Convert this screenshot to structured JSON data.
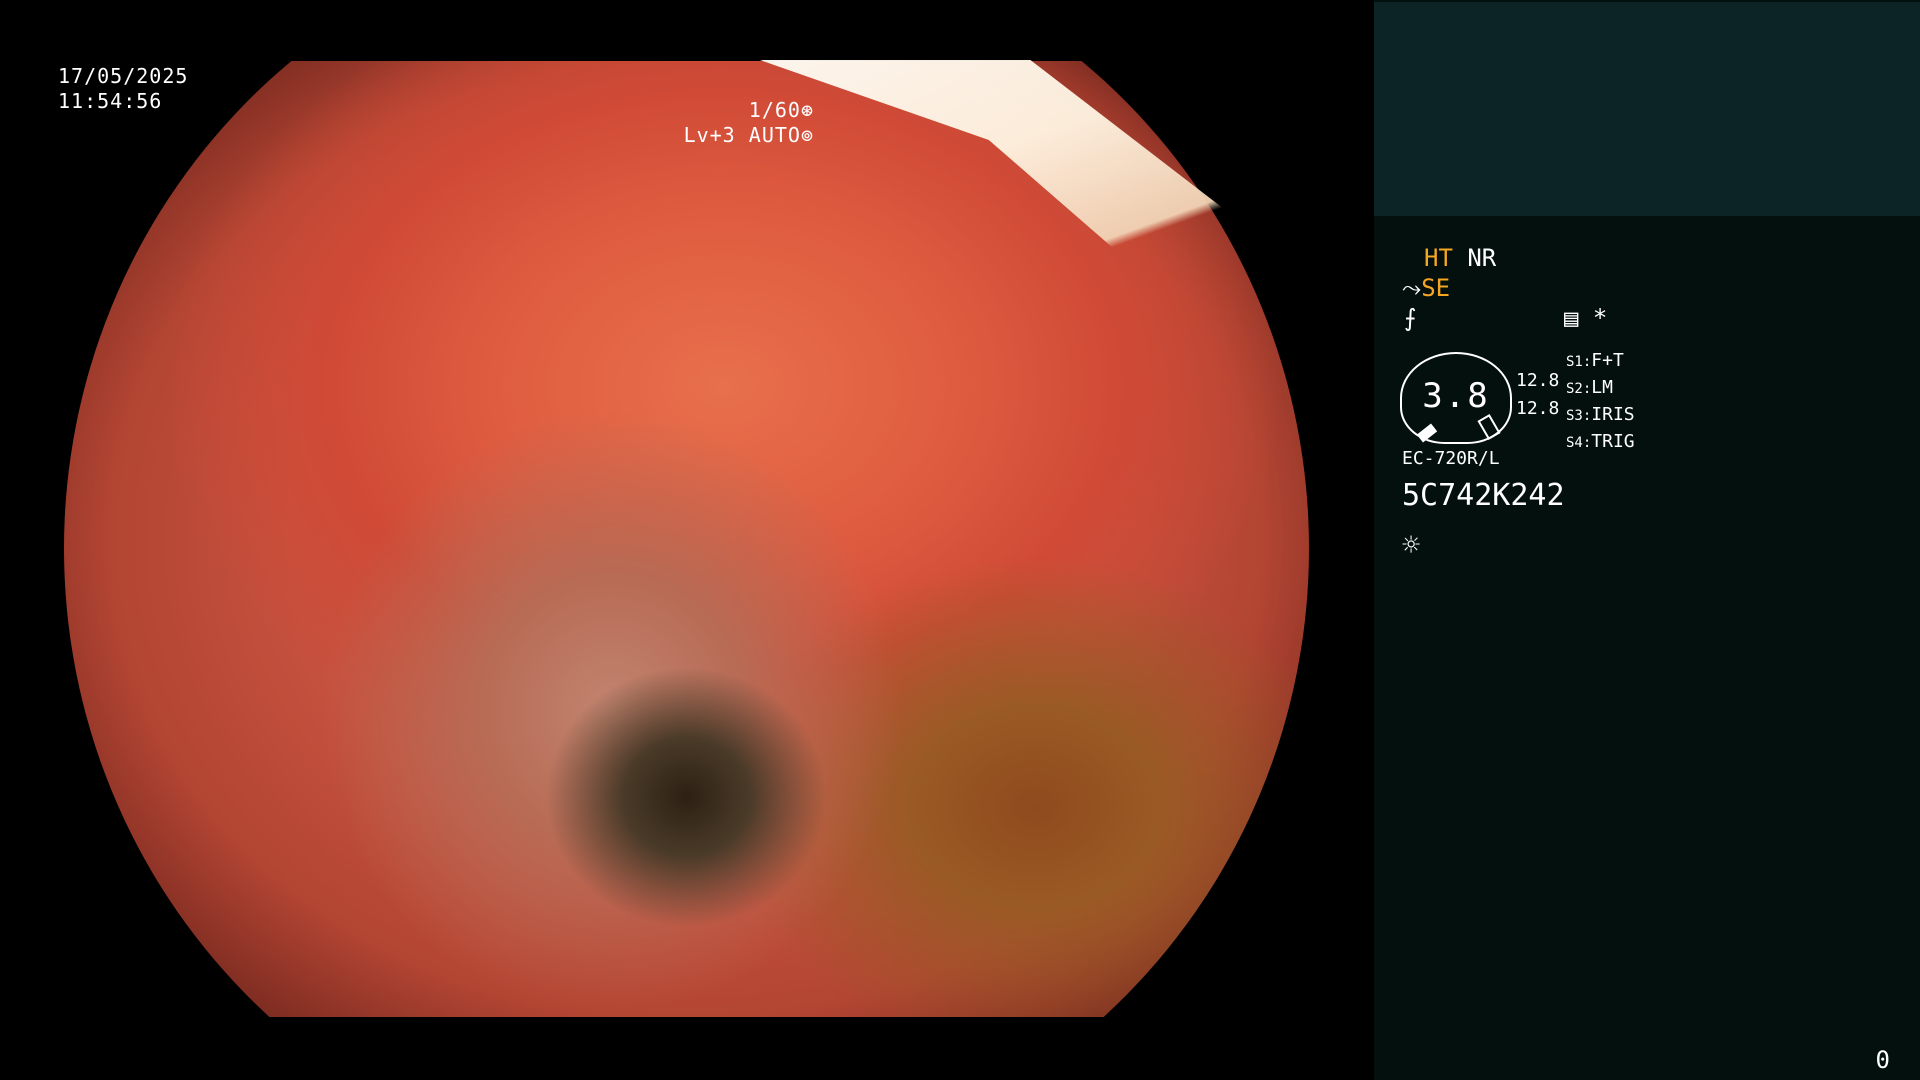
{
  "overlay": {
    "date": "17/05/2025",
    "time": "11:54:56",
    "shutter": "1/60",
    "shutter_icon": "aperture-icon",
    "level": "Lv+3",
    "auto_label": "AUTO",
    "auto_icon": "iris-icon"
  },
  "panel": {
    "mode_ht": "HT",
    "mode_nr": "NR",
    "mode_se": "SE",
    "icons": {
      "se_prefix": "⤳",
      "enhance": "⨍",
      "record": "▤",
      "asterisk": "*",
      "light": "☼"
    },
    "gauge_value": "3.8",
    "scale_top": "12.8",
    "scale_bottom": "12.8",
    "switches": [
      {
        "key": "S1:",
        "value": "F+T"
      },
      {
        "key": "S2:",
        "value": "LM"
      },
      {
        "key": "S3:",
        "value": "IRIS"
      },
      {
        "key": "S4:",
        "value": "TRIG"
      }
    ],
    "scope_model": "EC-720R/L",
    "serial": "5C742K242",
    "counter": "0"
  },
  "colors": {
    "accent": "#f5a623",
    "panel_bg": "#04100e",
    "panel_top": "#0d2426"
  }
}
